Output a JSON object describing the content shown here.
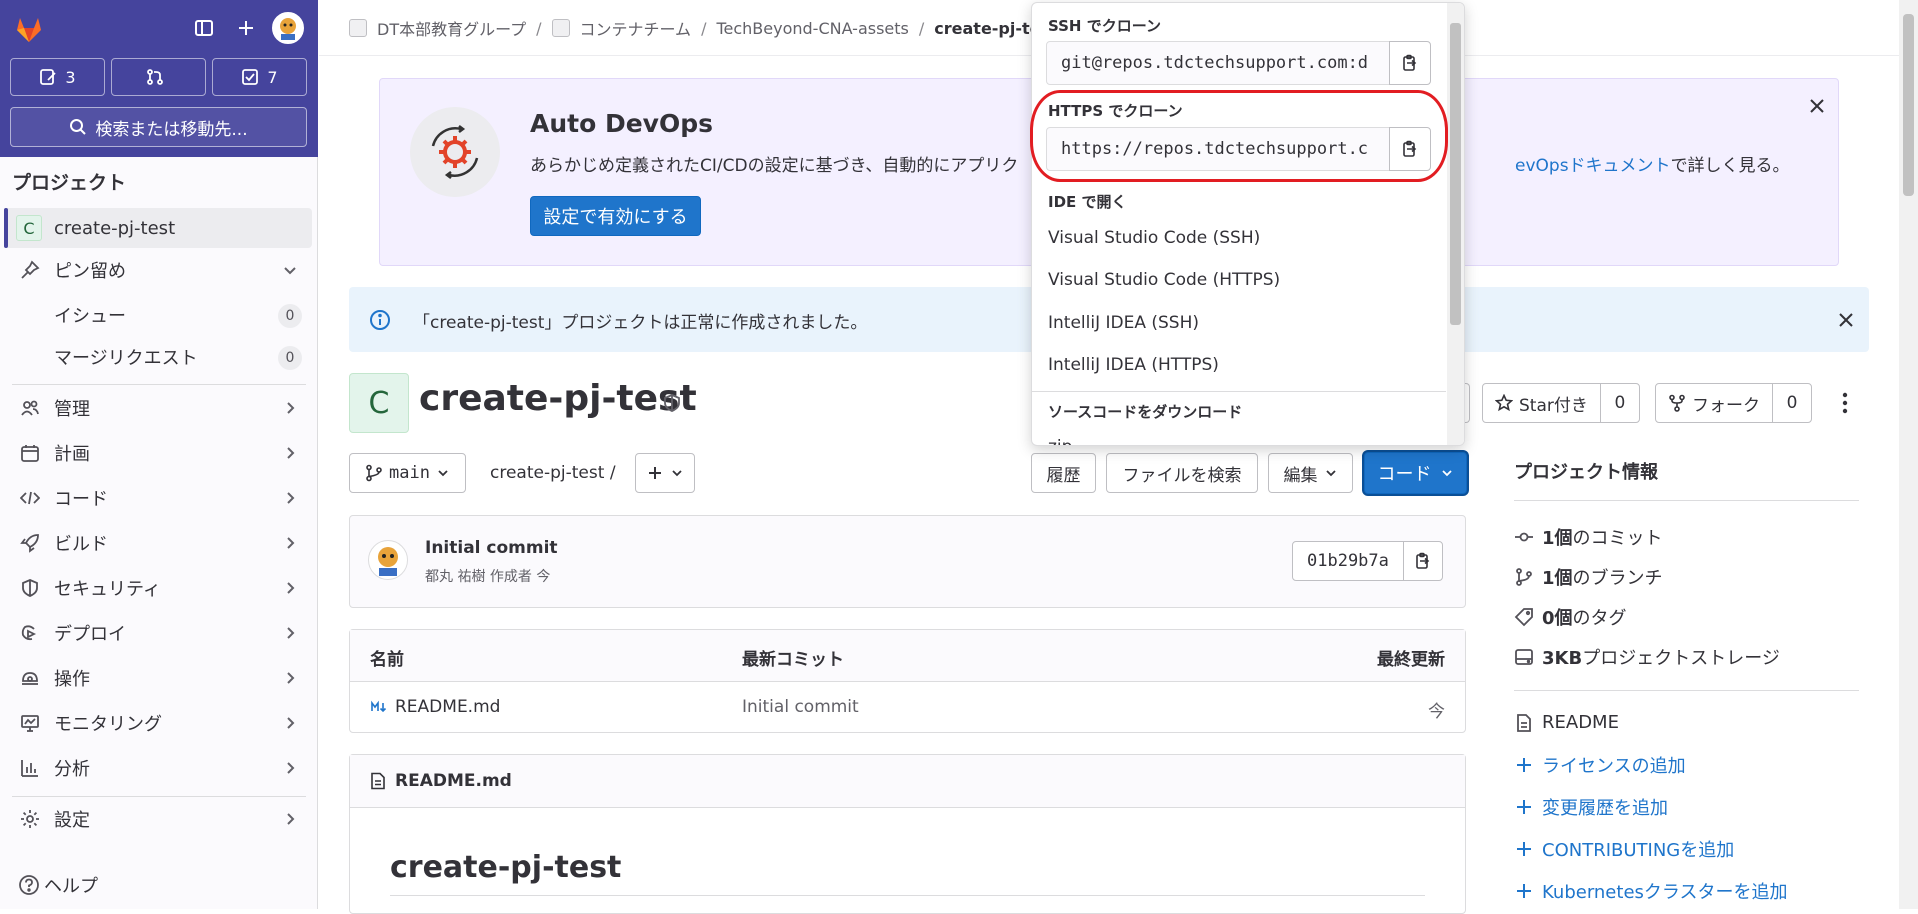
{
  "sidebar": {
    "counters": [
      {
        "icon": "issues-icon",
        "value": "3"
      },
      {
        "icon": "merge-request-icon",
        "value": ""
      },
      {
        "icon": "todo-icon",
        "value": "7"
      }
    ],
    "search_label": "検索または移動先...",
    "section_title": "プロジェクト",
    "project": {
      "avatar_letter": "C",
      "name": "create-pj-test"
    },
    "pinned": {
      "label": "ピン留め"
    },
    "pinned_items": [
      {
        "label": "イシュー",
        "count": "0"
      },
      {
        "label": "マージリクエスト",
        "count": "0"
      }
    ],
    "menu": [
      {
        "label": "管理",
        "icon": "manage-icon"
      },
      {
        "label": "計画",
        "icon": "plan-icon"
      },
      {
        "label": "コード",
        "icon": "code-icon"
      },
      {
        "label": "ビルド",
        "icon": "rocket-icon"
      },
      {
        "label": "セキュリティ",
        "icon": "shield-icon"
      },
      {
        "label": "デプロイ",
        "icon": "deploy-icon"
      },
      {
        "label": "操作",
        "icon": "operate-icon"
      },
      {
        "label": "モニタリング",
        "icon": "monitor-icon"
      },
      {
        "label": "分析",
        "icon": "analytics-icon"
      },
      {
        "label": "設定",
        "icon": "gear-icon"
      }
    ],
    "help_label": "ヘルプ"
  },
  "breadcrumb": {
    "items": [
      "DT本部教育グループ",
      "コンテナチーム",
      "TechBeyond-CNA-assets"
    ],
    "current": "create-pj-test"
  },
  "banner": {
    "title": "Auto DevOps",
    "text": "あらかじめ定義されたCI/CDの設定に基づき、自動的にアプリク",
    "link": "evOpsドキュメント",
    "text_after": "で詳しく見る。",
    "button": "設定で有効にする"
  },
  "alert": {
    "text": "「create-pj-test」プロジェクトは正常に作成されました。"
  },
  "project": {
    "avatar_letter": "C",
    "title": "create-pj-test",
    "star_label": "Star付き",
    "star_count": "0",
    "fork_label": "フォーク",
    "fork_count": "0"
  },
  "repo": {
    "branch": "main",
    "path": "create-pj-test",
    "path_sep": "/",
    "history_button": "履歴",
    "find_file_button": "ファイルを検索",
    "edit_button": "編集",
    "code_button": "コード"
  },
  "commit": {
    "title": "Initial commit",
    "author": "都丸 祐樹",
    "meta_suffix": "作成者 今",
    "sha": "01b29b7a"
  },
  "file_table": {
    "headers": [
      "名前",
      "最新コミット",
      "最終更新"
    ],
    "rows": [
      {
        "name": "README.md",
        "commit": "Initial commit",
        "updated": "今"
      }
    ]
  },
  "readme": {
    "header": "README.md",
    "heading": "create-pj-test"
  },
  "project_info": {
    "title": "プロジェクト情報",
    "stats": [
      {
        "icon": "commit-icon",
        "bold": "1個",
        "rest": "のコミット"
      },
      {
        "icon": "branch-icon",
        "bold": "1個",
        "rest": "のブランチ"
      },
      {
        "icon": "tag-icon",
        "bold": "0個",
        "rest": "のタグ"
      },
      {
        "icon": "storage-icon",
        "bold": "3KB",
        "rest": "プロジェクトストレージ"
      }
    ],
    "readme": "README",
    "links": [
      "ライセンスの追加",
      "変更履歴を追加",
      "CONTRIBUTINGを追加",
      "Kubernetesクラスターを追加"
    ]
  },
  "clone_dropdown": {
    "ssh_label": "SSH でクローン",
    "ssh_url": "git@repos.tdctechsupport.com:d",
    "https_label": "HTTPS でクローン",
    "https_url": "https://repos.tdctechsupport.c",
    "ide_label": "IDE で開く",
    "ide_items": [
      "Visual Studio Code (SSH)",
      "Visual Studio Code (HTTPS)",
      "IntelliJ IDEA (SSH)",
      "IntelliJ IDEA (HTTPS)"
    ],
    "download_label": "ソースコードをダウンロード",
    "download_first": "zip"
  },
  "colors": {
    "sidebar_top": "#45449d",
    "primary": "#1f75cb",
    "highlight": "#e21d22"
  }
}
